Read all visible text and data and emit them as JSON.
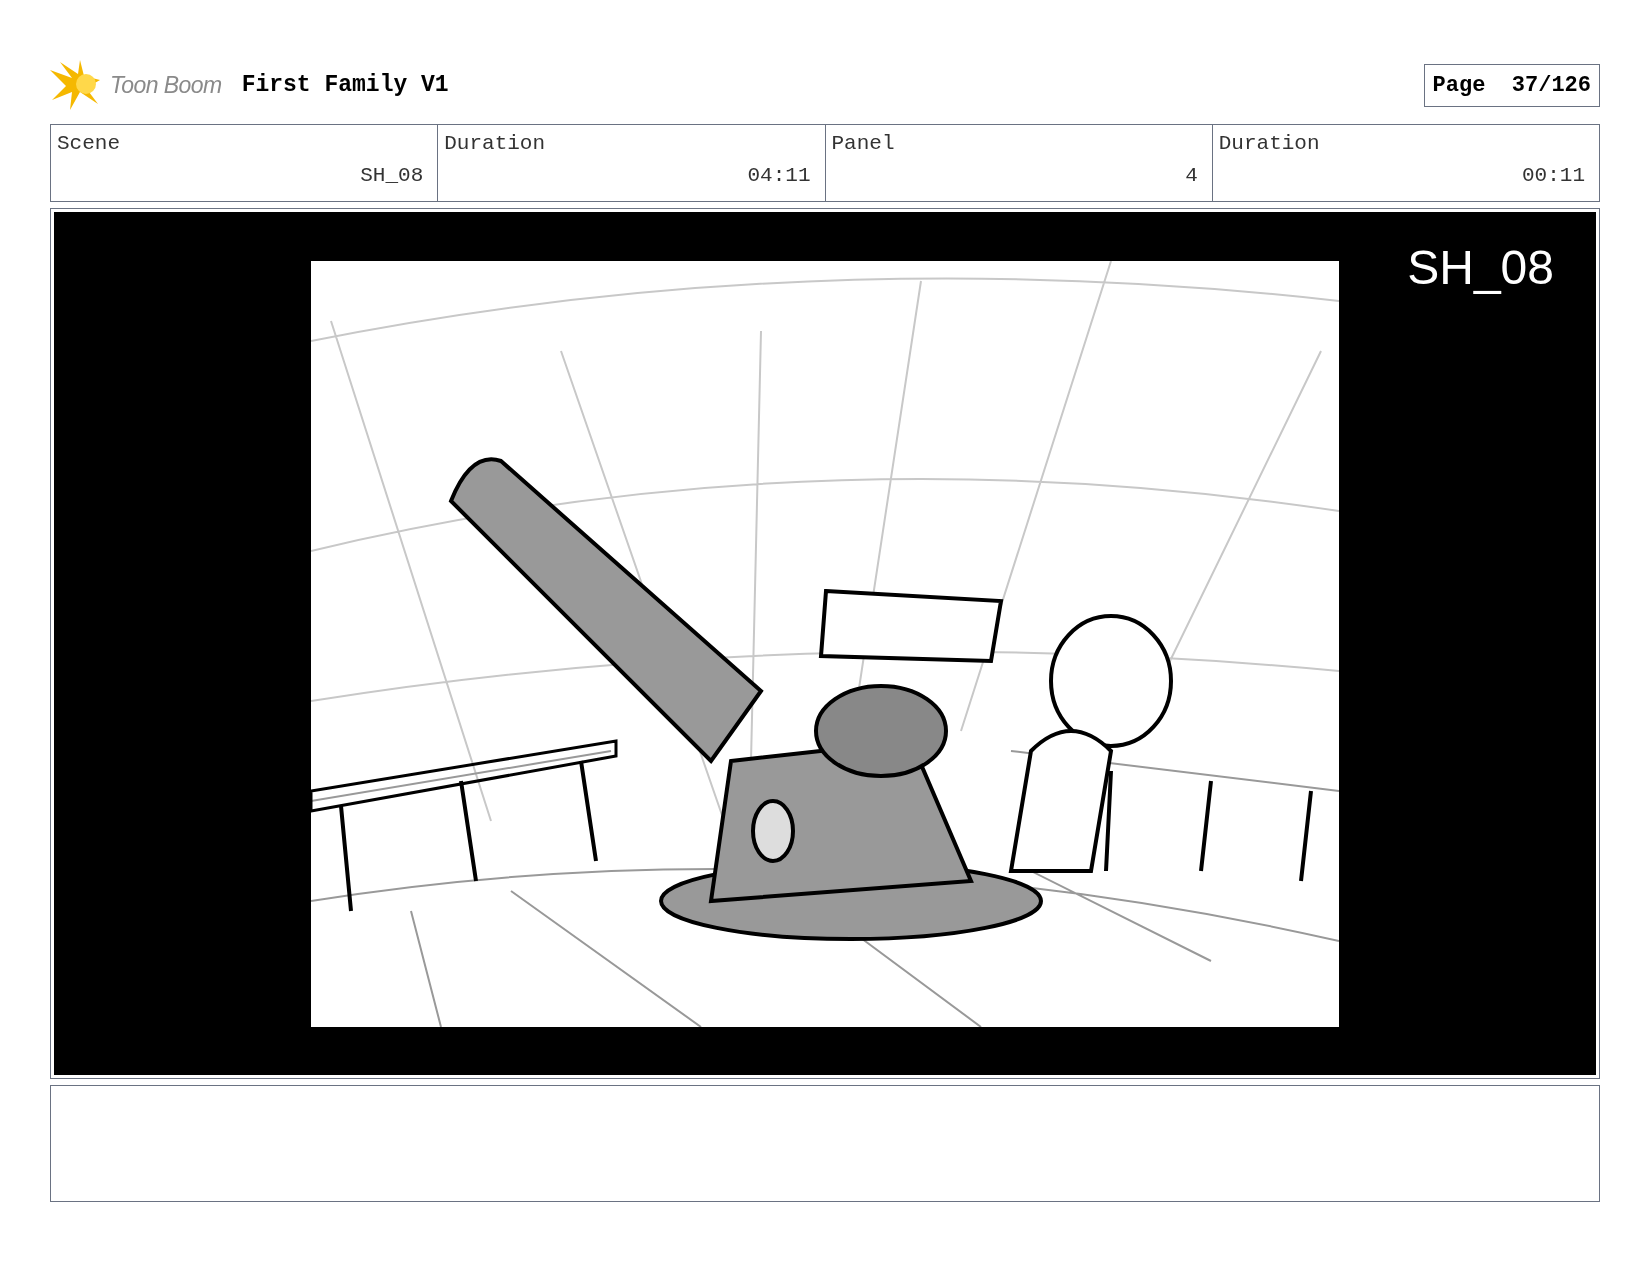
{
  "header": {
    "logo_text": "Toon Boom",
    "title": "First Family V1",
    "page_label": "Page",
    "page_number": "37/126"
  },
  "fields": [
    {
      "label": "Scene",
      "value": "SH_08"
    },
    {
      "label": "Duration",
      "value": "04:11"
    },
    {
      "label": "Panel",
      "value": "4"
    },
    {
      "label": "Duration",
      "value": "00:11"
    }
  ],
  "panel": {
    "overlay_label": "SH_08"
  }
}
